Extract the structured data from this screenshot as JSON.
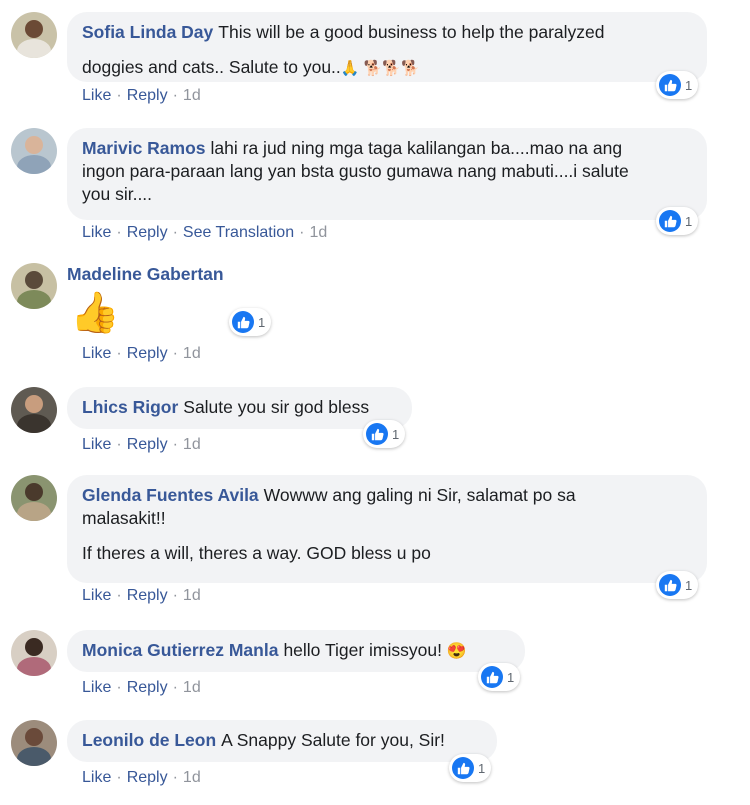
{
  "actions": {
    "like": "Like",
    "reply": "Reply",
    "see_translation": "See Translation",
    "sep": "·"
  },
  "comments": [
    {
      "name": "Sofia Linda Day",
      "text": "This will be a good business to help the paralyzed",
      "text2": "doggies and cats.. Salute to you..",
      "emoji": "🙏 🐕🐕🐕",
      "time": "1d",
      "reactions": "1"
    },
    {
      "name": "Marivic Ramos",
      "text": "lahi ra jud ning mga taga kalilangan ba....mao na ang",
      "text2": "ingon para-paraan lang yan bsta gusto gumawa nang mabuti....i salute",
      "text3": "you sir....",
      "time": "1d",
      "reactions": "1"
    },
    {
      "name": "Madeline Gabertan",
      "emoji": "👍",
      "time": "1d",
      "reactions": "1"
    },
    {
      "name": "Lhics Rigor",
      "text": "Salute you sir god bless",
      "time": "1d",
      "reactions": "1"
    },
    {
      "name": "Glenda Fuentes Avila",
      "text": "Wowww ang galing ni Sir, salamat po sa",
      "text2": "malasakit!!",
      "text3": "If theres a will, theres a way. GOD bless u po",
      "time": "1d",
      "reactions": "1"
    },
    {
      "name": "Monica Gutierrez Manla",
      "text": "hello Tiger imissyou!",
      "emoji": "😍",
      "time": "1d",
      "reactions": "1"
    },
    {
      "name": "Leonilo de Leon",
      "text": "A Snappy Salute for you, Sir!",
      "time": "1d",
      "reactions": "1"
    }
  ],
  "colors": {
    "link": "#385898",
    "bubble": "#f2f3f5",
    "like_blue": "#1877f2",
    "meta": "#90949c"
  },
  "icons": {
    "reaction": "like-thumb-icon"
  }
}
